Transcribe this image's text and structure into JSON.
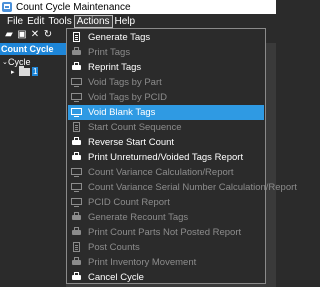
{
  "window": {
    "title": "Count Cycle Maintenance"
  },
  "menubar": {
    "items": [
      "File",
      "Edit",
      "Tools",
      "Actions",
      "Help"
    ],
    "active": "Actions"
  },
  "toolbar": {
    "buttons": [
      {
        "icon": "open-folder-icon",
        "glyph": "▰"
      },
      {
        "icon": "save-icon",
        "glyph": "▣"
      },
      {
        "icon": "delete-icon",
        "glyph": "✕"
      },
      {
        "icon": "refresh-icon",
        "glyph": "↻"
      }
    ]
  },
  "left_panel": {
    "header": "Count Cycle",
    "tree_root": "Cycle",
    "tree_item_badge": "1"
  },
  "dropdown": {
    "items": [
      {
        "label": "Generate Tags",
        "enabled": true,
        "icon": "doc-icon"
      },
      {
        "label": "Print Tags",
        "enabled": false,
        "icon": "printer-icon"
      },
      {
        "label": "Reprint Tags",
        "enabled": true,
        "icon": "printer-icon"
      },
      {
        "label": "Void Tags by Part",
        "enabled": false,
        "icon": "screen-icon"
      },
      {
        "label": "Void Tags by PCID",
        "enabled": false,
        "icon": "screen-icon"
      },
      {
        "label": "Void Blank Tags",
        "enabled": true,
        "highlighted": true,
        "icon": "screen-icon"
      },
      {
        "label": "Start Count Sequence",
        "enabled": false,
        "icon": "doc-icon"
      },
      {
        "label": "Reverse Start Count",
        "enabled": true,
        "icon": "printer-icon"
      },
      {
        "label": "Print Unreturned/Voided Tags Report",
        "enabled": true,
        "icon": "printer-icon"
      },
      {
        "label": "Count Variance Calculation/Report",
        "enabled": false,
        "icon": "screen-icon"
      },
      {
        "label": "Count Variance Serial Number Calculation/Report",
        "enabled": false,
        "icon": "screen-icon"
      },
      {
        "label": "PCID Count Report",
        "enabled": false,
        "icon": "screen-icon"
      },
      {
        "label": "Generate Recount Tags",
        "enabled": false,
        "icon": "printer-icon"
      },
      {
        "label": "Print Count Parts Not Posted Report",
        "enabled": false,
        "icon": "printer-icon"
      },
      {
        "label": "Post Counts",
        "enabled": false,
        "icon": "doc-icon"
      },
      {
        "label": "Print Inventory Movement",
        "enabled": false,
        "icon": "printer-icon"
      },
      {
        "label": "Cancel Cycle",
        "enabled": true,
        "icon": "printer-icon"
      }
    ]
  },
  "colors": {
    "highlight": "#2f9ae3",
    "panel_header": "#1e86d8",
    "background": "#2b2b2b",
    "disabled_text": "#8c8c8c"
  }
}
